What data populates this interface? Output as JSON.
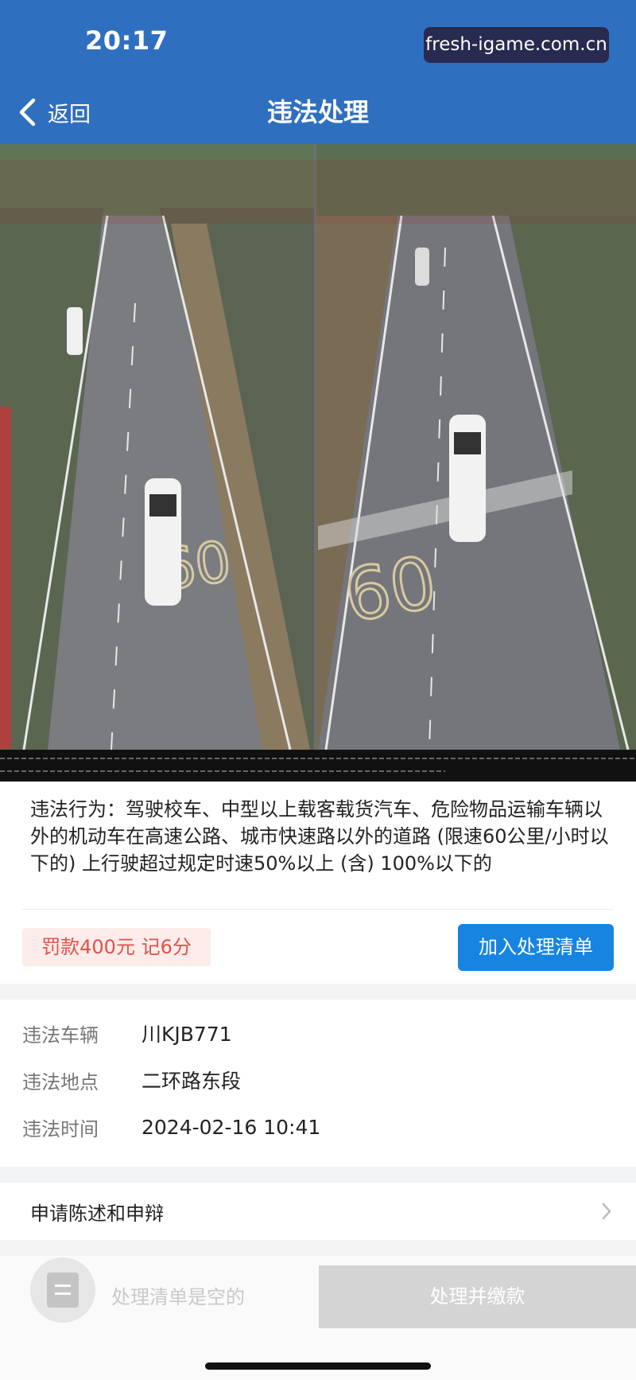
{
  "status_bar": {
    "time": "20:17"
  },
  "watermark": {
    "text": "fresh-igame.com.cn"
  },
  "nav": {
    "back_label": "返回",
    "title": "违法处理"
  },
  "violation": {
    "description": "违法行为：驾驶校车、中型以上载客载货汽车、危险物品运输车辆以外的机动车在高速公路、城市快速路以外的道路 (限速60公里/小时以下的) 上行驶超过规定时速50%以上 (含) 100%以下的",
    "penalty": "罚款400元  记6分",
    "add_button": "加入处理清单"
  },
  "info": [
    {
      "label": "违法车辆",
      "value": "川KJB771"
    },
    {
      "label": "违法地点",
      "value": "二环路东段"
    },
    {
      "label": "违法时间",
      "value": "2024-02-16 10:41"
    }
  ],
  "appeal": {
    "label": "申请陈述和申辩"
  },
  "bottom": {
    "cart_text": "处理清单是空的",
    "pay_button": "处理并缴款"
  },
  "colors": {
    "primary": "#2f6fbf",
    "button_blue": "#1784e2",
    "penalty_red": "#e0524a",
    "disabled_gray": "#d4d4d4"
  },
  "icons": {
    "back": "chevron-left-icon",
    "appeal": "chevron-right-icon",
    "cart": "list-icon"
  }
}
